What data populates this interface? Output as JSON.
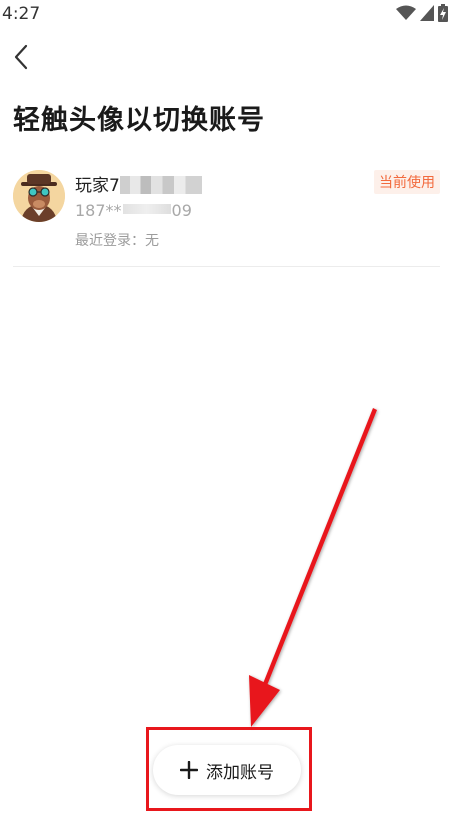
{
  "status_bar": {
    "time": "4:27",
    "icons": [
      "wifi-icon",
      "signal-icon",
      "battery-charging-icon"
    ]
  },
  "header": {
    "back_icon": "chevron-left-icon",
    "title": "轻触头像以切换账号"
  },
  "account": {
    "name_prefix": "玩家7",
    "phone_prefix": "187**",
    "phone_suffix": "09",
    "last_login": "最近登录：无",
    "badge": "当前使用"
  },
  "add_button": {
    "icon": "plus-icon",
    "label": "添加账号"
  },
  "colors": {
    "badge_text": "#f26a3d",
    "badge_bg": "#fdf0ea",
    "annotation": "#e8171c"
  }
}
